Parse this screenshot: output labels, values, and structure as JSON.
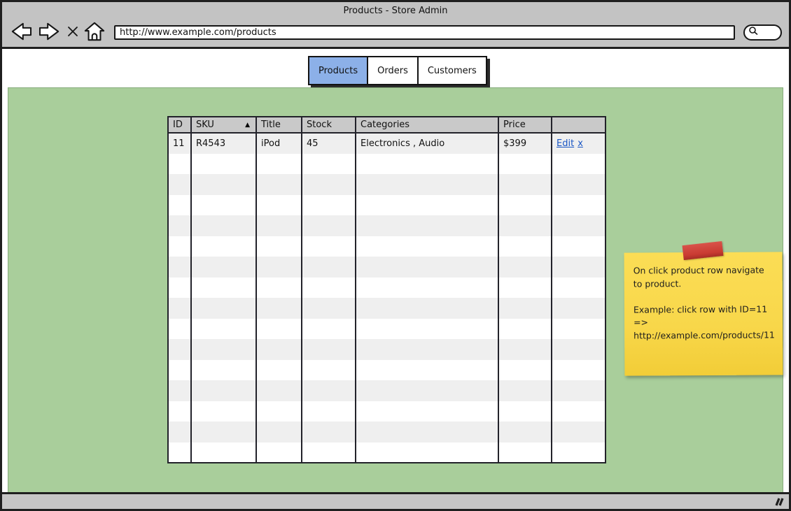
{
  "window": {
    "title": "Products - Store Admin"
  },
  "browser": {
    "url": "http://www.example.com/products",
    "toolbar": {
      "back_icon": "back-arrow",
      "forward_icon": "forward-arrow",
      "stop_icon": "stop-x",
      "home_icon": "home",
      "search_icon": "magnifier"
    }
  },
  "tabs": [
    {
      "label": "Products",
      "active": true
    },
    {
      "label": "Orders",
      "active": false
    },
    {
      "label": "Customers",
      "active": false
    }
  ],
  "table": {
    "columns": [
      "ID",
      "SKU",
      "Title",
      "Stock",
      "Categories",
      "Price",
      ""
    ],
    "sort": {
      "column_index": 1,
      "direction": "asc",
      "icon": "sort-asc-triangle"
    },
    "rows": [
      {
        "cells": [
          "11",
          "R4543",
          "iPod",
          "45",
          "Electronics , Audio",
          "$399"
        ],
        "actions": {
          "edit_label": "Edit",
          "delete_label": "x"
        }
      }
    ],
    "empty_row_count": 15
  },
  "note": {
    "paragraphs": [
      "On click product row navigate to product.",
      "Example: click row with ID=11 => http://example.com/products/11"
    ]
  },
  "statusbar": {
    "resize_icon": "resize-grip"
  },
  "colors": {
    "chrome_gray": "#c3c3c3",
    "content_green": "#a9ce9b",
    "active_tab_blue": "#8cb0e8",
    "table_header_gray": "#c9c9c9",
    "row_stripe_gray": "#efefef",
    "link_blue": "#1a56c4",
    "note_yellow": "#f8d74a",
    "tape_red": "#c93b32"
  }
}
